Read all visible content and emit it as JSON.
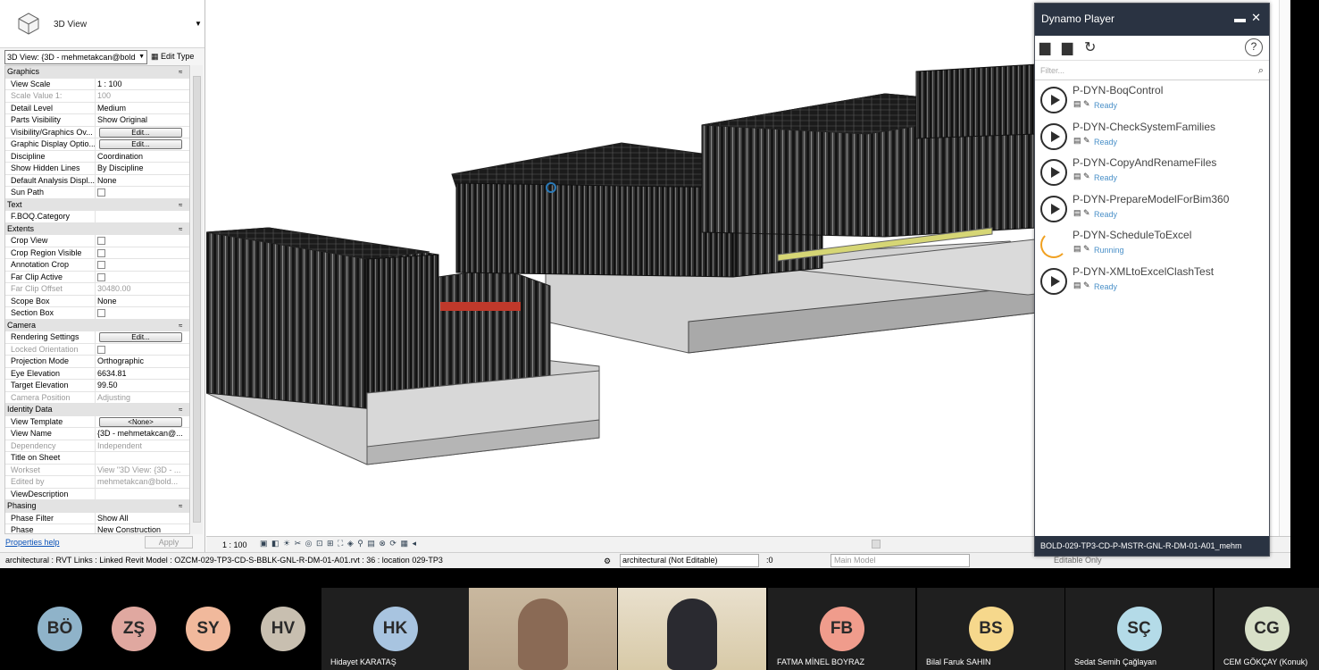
{
  "properties": {
    "type_name": "3D View",
    "selector": "3D View: {3D - mehmetakcan@bold",
    "edit_type": "Edit Type",
    "help": "Properties help",
    "apply": "Apply",
    "groups": [
      {
        "name": "Graphics",
        "rows": [
          {
            "k": "View Scale",
            "v": "1 : 100"
          },
          {
            "k": "Scale Value    1:",
            "v": "100",
            "dim": true
          },
          {
            "k": "Detail Level",
            "v": "Medium"
          },
          {
            "k": "Parts Visibility",
            "v": "Show Original"
          },
          {
            "k": "Visibility/Graphics Ov...",
            "btn": "Edit..."
          },
          {
            "k": "Graphic Display Optio...",
            "btn": "Edit..."
          },
          {
            "k": "Discipline",
            "v": "Coordination"
          },
          {
            "k": "Show Hidden Lines",
            "v": "By Discipline"
          },
          {
            "k": "Default Analysis Displ...",
            "v": "None"
          },
          {
            "k": "Sun Path",
            "cb": true
          }
        ]
      },
      {
        "name": "Text",
        "rows": [
          {
            "k": "F.BOQ.Category",
            "v": ""
          }
        ]
      },
      {
        "name": "Extents",
        "rows": [
          {
            "k": "Crop View",
            "cb": true
          },
          {
            "k": "Crop Region Visible",
            "cb": true
          },
          {
            "k": "Annotation Crop",
            "cb": true
          },
          {
            "k": "Far Clip Active",
            "cb": true
          },
          {
            "k": "Far Clip Offset",
            "v": "30480.00",
            "dim": true
          },
          {
            "k": "Scope Box",
            "v": "None"
          },
          {
            "k": "Section Box",
            "cb": true
          }
        ]
      },
      {
        "name": "Camera",
        "rows": [
          {
            "k": "Rendering Settings",
            "btn": "Edit..."
          },
          {
            "k": "Locked Orientation",
            "cb": true,
            "dim": true
          },
          {
            "k": "Projection Mode",
            "v": "Orthographic"
          },
          {
            "k": "Eye Elevation",
            "v": "6634.81"
          },
          {
            "k": "Target Elevation",
            "v": "99.50"
          },
          {
            "k": "Camera Position",
            "v": "Adjusting",
            "dim": true
          }
        ]
      },
      {
        "name": "Identity Data",
        "rows": [
          {
            "k": "View Template",
            "btn": "<None>"
          },
          {
            "k": "View Name",
            "v": "{3D - mehmetakcan@..."
          },
          {
            "k": "Dependency",
            "v": "Independent",
            "dim": true
          },
          {
            "k": "Title on Sheet",
            "v": ""
          },
          {
            "k": "Workset",
            "v": "View \"3D View: {3D - ...",
            "dim": true
          },
          {
            "k": "Edited by",
            "v": "mehmetakcan@bold...",
            "dim": true
          },
          {
            "k": "ViewDescription",
            "v": ""
          }
        ]
      },
      {
        "name": "Phasing",
        "rows": [
          {
            "k": "Phase Filter",
            "v": "Show All"
          },
          {
            "k": "Phase",
            "v": "New Construction"
          }
        ]
      }
    ]
  },
  "view_control": {
    "scale": "1 : 100"
  },
  "status": {
    "message": "architectural : RVT Links : Linked Revit Model : OZCM-029-TP3-CD-S-BBLK-GNL-R-DM-01-A01.rvt : 36 : location 029-TP3",
    "workset": "architectural (Not Editable)",
    "zero": ":0",
    "main_model": "Main Model",
    "editable_only": "Editable Only"
  },
  "dynamo": {
    "title": "Dynamo Player",
    "filter_placeholder": "Filter...",
    "scripts": [
      {
        "name": "P-DYN-BoqControl",
        "status": "Ready"
      },
      {
        "name": "P-DYN-CheckSystemFamilies",
        "status": "Ready"
      },
      {
        "name": "P-DYN-CopyAndRenameFiles",
        "status": "Ready"
      },
      {
        "name": "P-DYN-PrepareModelForBim360",
        "status": "Ready"
      },
      {
        "name": "P-DYN-ScheduleToExcel",
        "status": "Running"
      },
      {
        "name": "P-DYN-XMLtoExcelClashTest",
        "status": "Ready"
      }
    ],
    "footer": "BOLD-029-TP3-CD-P-MSTR-GNL-R-DM-01-A01_mehm"
  },
  "participants": [
    {
      "initials": "BÖ",
      "color": "#8fb3c9",
      "name": ""
    },
    {
      "initials": "ZŞ",
      "color": "#e0a8a0",
      "name": ""
    },
    {
      "initials": "SY",
      "color": "#f1b99c",
      "name": ""
    },
    {
      "initials": "HV",
      "color": "#c8bfb0",
      "name": ""
    },
    {
      "initials": "HK",
      "color": "#a8c4e0",
      "name": "Hidayet KARATAŞ"
    },
    {
      "initials": "FB",
      "color": "#f09c8c",
      "name": "FATMA MİNEL BOYRAZ"
    },
    {
      "initials": "BS",
      "color": "#f6d88c",
      "name": "Bilal Faruk SAHIN"
    },
    {
      "initials": "SÇ",
      "color": "#b4dbe8",
      "name": "Sedat Semih Çağlayan"
    },
    {
      "initials": "CG",
      "color": "#d8e0c8",
      "name": "CEM GÖKÇAY (Konuk)"
    }
  ]
}
